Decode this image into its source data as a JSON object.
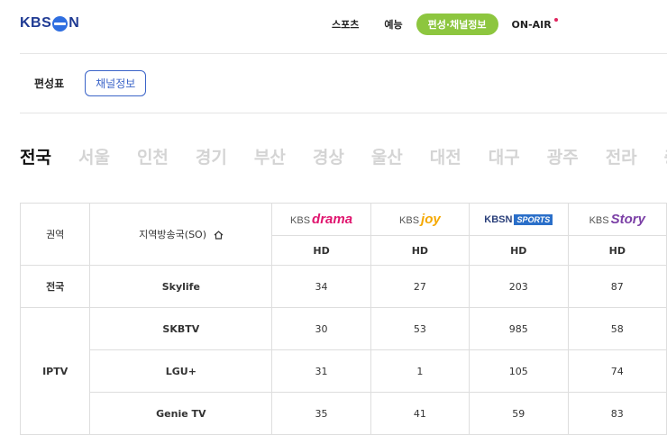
{
  "header": {
    "logo_text_left": "KBS",
    "logo_text_right": "N",
    "nav": [
      {
        "label": "스포츠",
        "active": false
      },
      {
        "label": "예능",
        "active": false
      },
      {
        "label": "편성·채널정보",
        "active": true
      },
      {
        "label": "ON-AIR",
        "active": false
      }
    ]
  },
  "subtabs": [
    {
      "label": "편성표",
      "active": false
    },
    {
      "label": "채널정보",
      "active": true
    }
  ],
  "regions": [
    {
      "label": "전국",
      "active": true
    },
    {
      "label": "서울",
      "active": false
    },
    {
      "label": "인천",
      "active": false
    },
    {
      "label": "경기",
      "active": false
    },
    {
      "label": "부산",
      "active": false
    },
    {
      "label": "경상",
      "active": false
    },
    {
      "label": "울산",
      "active": false
    },
    {
      "label": "대전",
      "active": false
    },
    {
      "label": "대구",
      "active": false
    },
    {
      "label": "광주",
      "active": false
    },
    {
      "label": "전라",
      "active": false
    },
    {
      "label": "충",
      "active": false
    }
  ],
  "table": {
    "col_region": "권역",
    "col_so": "지역방송국(SO)",
    "channels": [
      {
        "kbs": "KBS",
        "name": "drama",
        "color": "#e0166f",
        "quality": "HD"
      },
      {
        "kbs": "KBS",
        "name": "joy",
        "color": "#f5a800",
        "quality": "HD"
      },
      {
        "kbs": "KBSN",
        "name": "SPORTS",
        "color": "#2a6fc9",
        "quality": "HD"
      },
      {
        "kbs": "KBS",
        "name": "Story",
        "color": "#7b3fa6",
        "quality": "HD"
      }
    ],
    "groups": [
      {
        "region": "전국",
        "rows": [
          {
            "so": "Skylife",
            "values": [
              "34",
              "27",
              "203",
              "87"
            ]
          }
        ]
      },
      {
        "region": "IPTV",
        "rows": [
          {
            "so": "SKBTV",
            "values": [
              "30",
              "53",
              "985",
              "58"
            ]
          },
          {
            "so": "LGU+",
            "values": [
              "31",
              "1",
              "105",
              "74"
            ]
          },
          {
            "so": "Genie TV",
            "values": [
              "35",
              "41",
              "59",
              "83"
            ]
          }
        ]
      }
    ]
  }
}
